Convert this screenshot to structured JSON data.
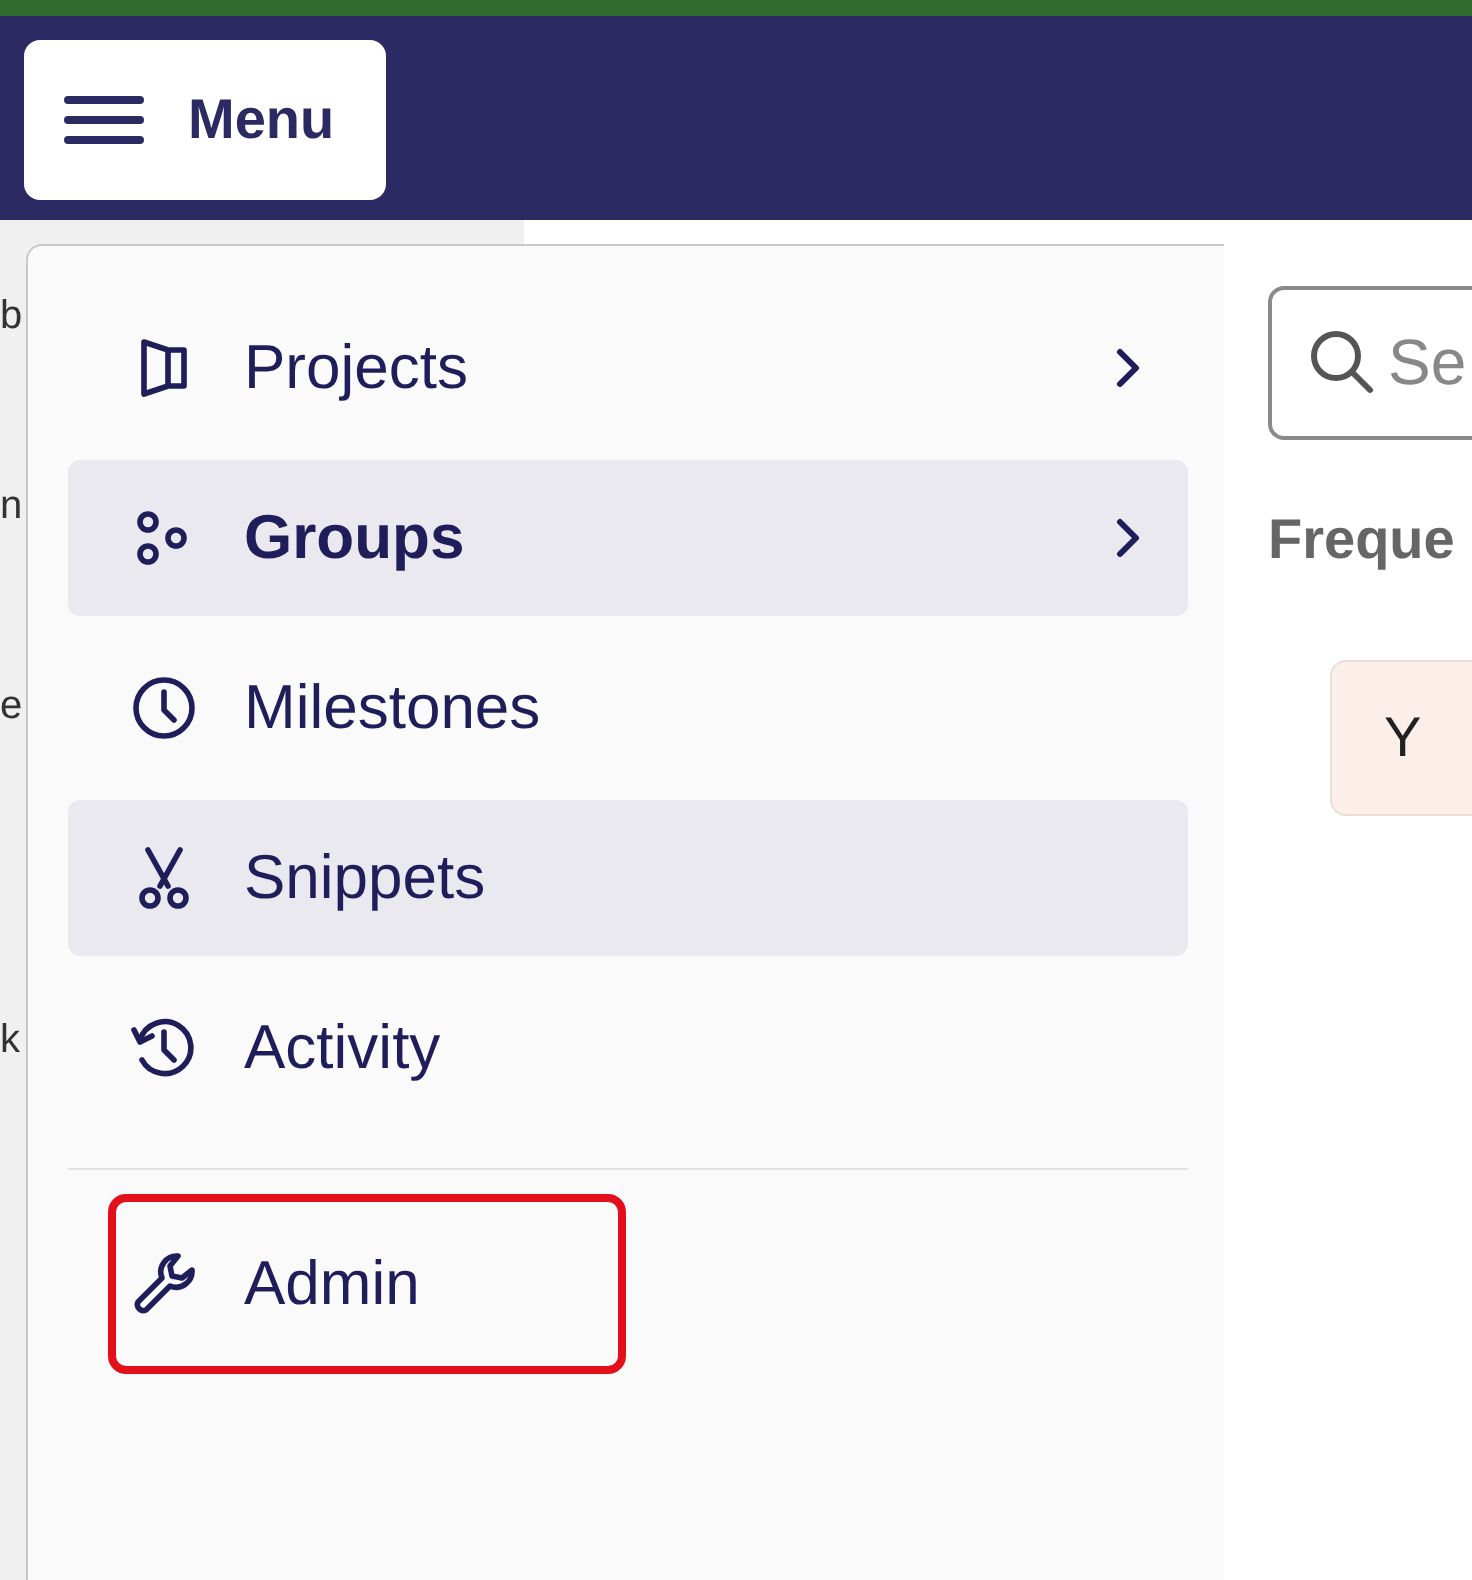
{
  "header": {
    "menu_button": {
      "label": "Menu"
    }
  },
  "background_letters": [
    "b",
    "n",
    "e",
    "k"
  ],
  "menu": {
    "items": [
      {
        "label": "Projects",
        "kind": "projects",
        "has_submenu": true,
        "selected": false,
        "highlighted": false
      },
      {
        "label": "Groups",
        "kind": "groups",
        "has_submenu": true,
        "selected": true,
        "highlighted": true
      },
      {
        "label": "Milestones",
        "kind": "milestones",
        "has_submenu": false,
        "selected": false,
        "highlighted": false
      },
      {
        "label": "Snippets",
        "kind": "snippets",
        "has_submenu": false,
        "selected": false,
        "highlighted": true
      },
      {
        "label": "Activity",
        "kind": "activity",
        "has_submenu": false,
        "selected": false,
        "highlighted": false
      }
    ],
    "footer_items": [
      {
        "label": "Admin",
        "kind": "admin",
        "annotated": true
      }
    ]
  },
  "page": {
    "search": {
      "placeholder": "Se"
    },
    "heading": "Freque",
    "chip": "Y"
  }
}
